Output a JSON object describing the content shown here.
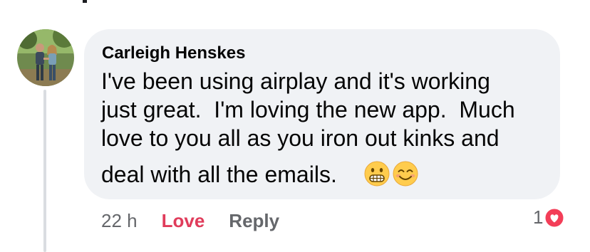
{
  "comment": {
    "author": "Carleigh Henskes",
    "lines": [
      "I've been using airplay and it's working",
      "just great.  I'm loving the new app.  Much",
      "love to you all as you iron out kinks and",
      "deal with all the emails."
    ],
    "emojis": [
      "grimacing-face-emoji",
      "smiling-face-with-smiling-eyes-emoji"
    ],
    "timestamp": "22 h",
    "love_label": "Love",
    "reply_label": "Reply",
    "reaction": {
      "count": "1",
      "icon": "heart-reaction-icon",
      "color": "#f33e58"
    }
  },
  "colors": {
    "bubble": "#f0f2f5",
    "love": "#e03c5b",
    "meta": "#65676b"
  }
}
